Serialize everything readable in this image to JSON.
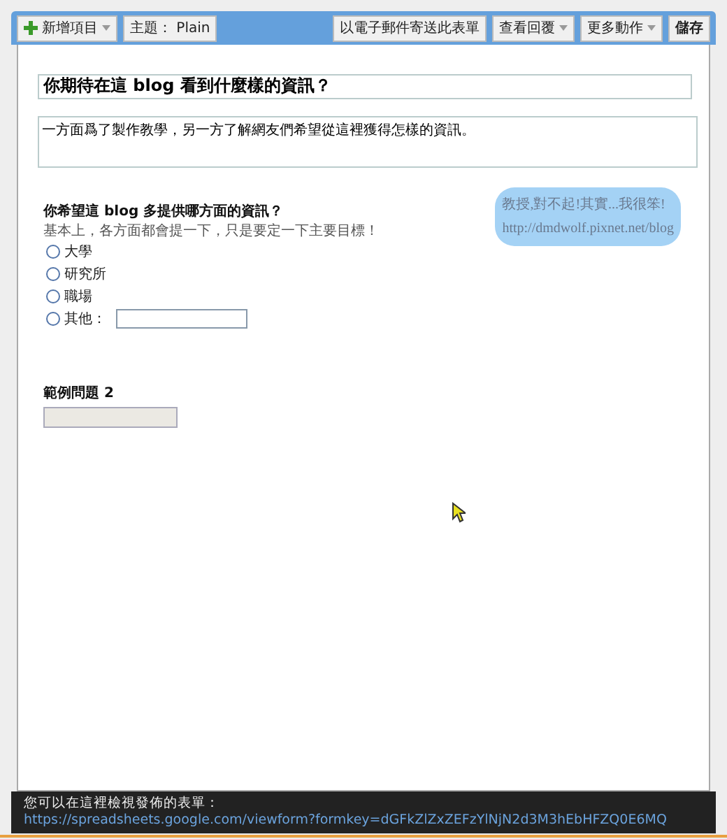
{
  "toolbar": {
    "left": [
      {
        "label": "新增項目",
        "kind": "add"
      },
      {
        "label": "主題： Plain",
        "kind": "plain"
      }
    ],
    "right": [
      {
        "label": "以電子郵件寄送此表單",
        "kind": "plain"
      },
      {
        "label": "查看回覆",
        "kind": "dropdown"
      },
      {
        "label": "更多動作",
        "kind": "dropdown"
      },
      {
        "label": "儲存",
        "kind": "bold"
      }
    ]
  },
  "form": {
    "title": "你期待在這 blog 看到什麼樣的資訊？",
    "description": "一方面爲了製作教學，另一方了解網友們希望從這裡獲得怎樣的資訊。"
  },
  "questions": [
    {
      "title": "你希望這 blog 多提供哪方面的資訊？",
      "help": "基本上，各方面都會提一下，只是要定一下主要目標！",
      "kind": "radio",
      "options": [
        {
          "label": "大學",
          "selected": false
        },
        {
          "label": "研究所",
          "selected": false
        },
        {
          "label": "職場",
          "selected": false
        },
        {
          "label": "其他：",
          "selected": false,
          "other": true
        }
      ]
    },
    {
      "title": "範例問題 2",
      "kind": "text"
    }
  ],
  "bubble": {
    "lines": [
      "教授,對不起!其實...我很笨!",
      "http://dmdwolf.pixnet.net/blog"
    ]
  },
  "footer": {
    "text": "您可以在這裡檢視發佈的表單：",
    "link": "https://spreadsheets.google.com/viewform?formkey=dGFkZlZxZEFzYlNjN2d3M3hEbHFZQ0E6MQ"
  }
}
